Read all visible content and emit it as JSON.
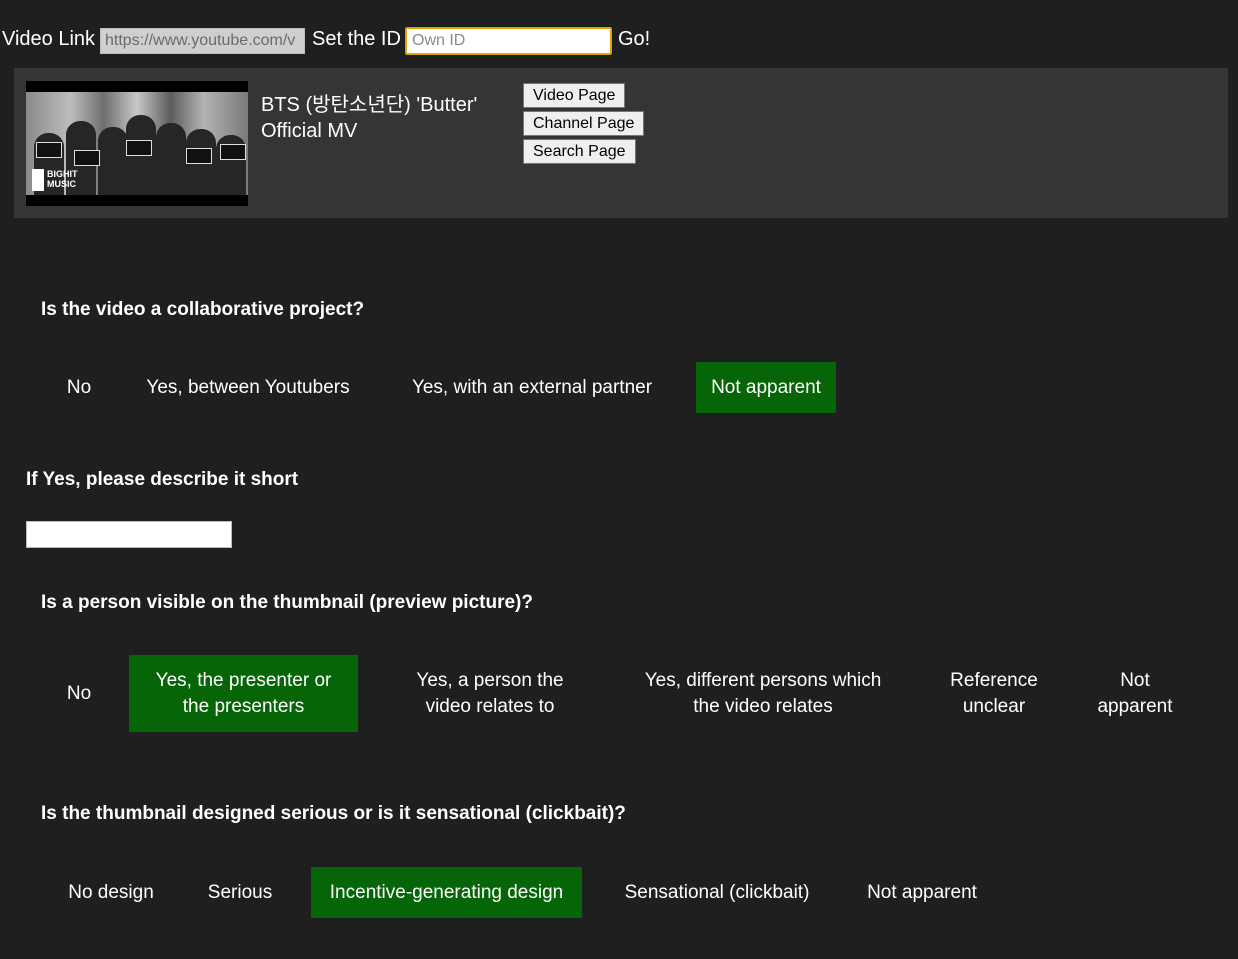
{
  "topbar": {
    "video_link_label": "Video Link",
    "video_link_value": "https://www.youtube.com/v",
    "set_id_label": "Set the ID",
    "id_placeholder": "Own ID",
    "go_label": "Go!"
  },
  "video": {
    "title": "BTS (방탄소년단) 'Butter' Official MV",
    "thumbnail_logo_text": "BIGHIT MUSIC",
    "buttons": [
      "Video Page",
      "Channel Page",
      "Search Page"
    ]
  },
  "q1": {
    "question": "Is the video a collaborative project?",
    "options": [
      "No",
      "Yes, between Youtubers",
      "Yes, with an external partner",
      "Not apparent"
    ],
    "selected": "Not apparent"
  },
  "q_describe": {
    "label": "If Yes, please describe it short",
    "value": ""
  },
  "q2": {
    "question": "Is a person visible on the thumbnail (preview picture)?",
    "options": [
      "No",
      "Yes, the presenter or the presenters",
      "Yes, a person the video relates to",
      "Yes, different persons which the video relates",
      "Reference unclear",
      "Not apparent"
    ],
    "selected": "Yes, the presenter or the presenters"
  },
  "q3": {
    "question": "Is the thumbnail designed serious or is it sensational (clickbait)?",
    "options": [
      "No design",
      "Serious",
      "Incentive-generating design",
      "Sensational (clickbait)",
      "Not apparent"
    ],
    "selected": "Incentive-generating design"
  },
  "colors": {
    "background": "#1f1f1f",
    "panel": "#353535",
    "selected": "#066506",
    "focus_border": "#e2a400"
  }
}
